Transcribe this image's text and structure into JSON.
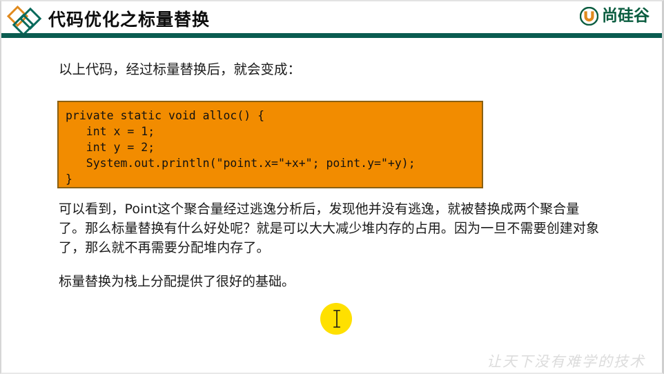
{
  "header": {
    "title": "代码优化之标量替换",
    "diamond_logo_icon": "diamond-logo-icon",
    "brand_mark_icon": "shangguigu-u-mark-icon",
    "brand_text": "尚硅谷",
    "colors": {
      "rule": "#0a5c50",
      "diamond_orange": "#E08A1E",
      "diamond_teal": "#0a6a5c",
      "brand_green": "#0a5c3f",
      "brand_orange": "#E08A1E"
    }
  },
  "content": {
    "intro": "以上代码，经过标量替换后，就会变成：",
    "code": "private static void alloc() {\n   int x = 1;\n   int y = 2;\n   System.out.println(\"point.x=\"+x+\"; point.y=\"+y);\n}",
    "code_colors": {
      "background": "#F28C00",
      "border": "#8a6012",
      "text": "#111111"
    },
    "paragraph_main": "可以看到，Point这个聚合量经过逃逸分析后，发现他并没有逃逸，就被替换成两个聚合量了。那么标量替换有什么好处呢？就是可以大大减少堆内存的占用。因为一旦不需要创建对象了，那么就不再需要分配堆内存了。",
    "paragraph_last": "标量替换为栈上分配提供了很好的基础。"
  },
  "cursor": {
    "halo_color": "#FFE000",
    "icon": "text-ibeam-cursor-icon"
  },
  "footer": {
    "watermark": "让天下没有难学的技术"
  }
}
